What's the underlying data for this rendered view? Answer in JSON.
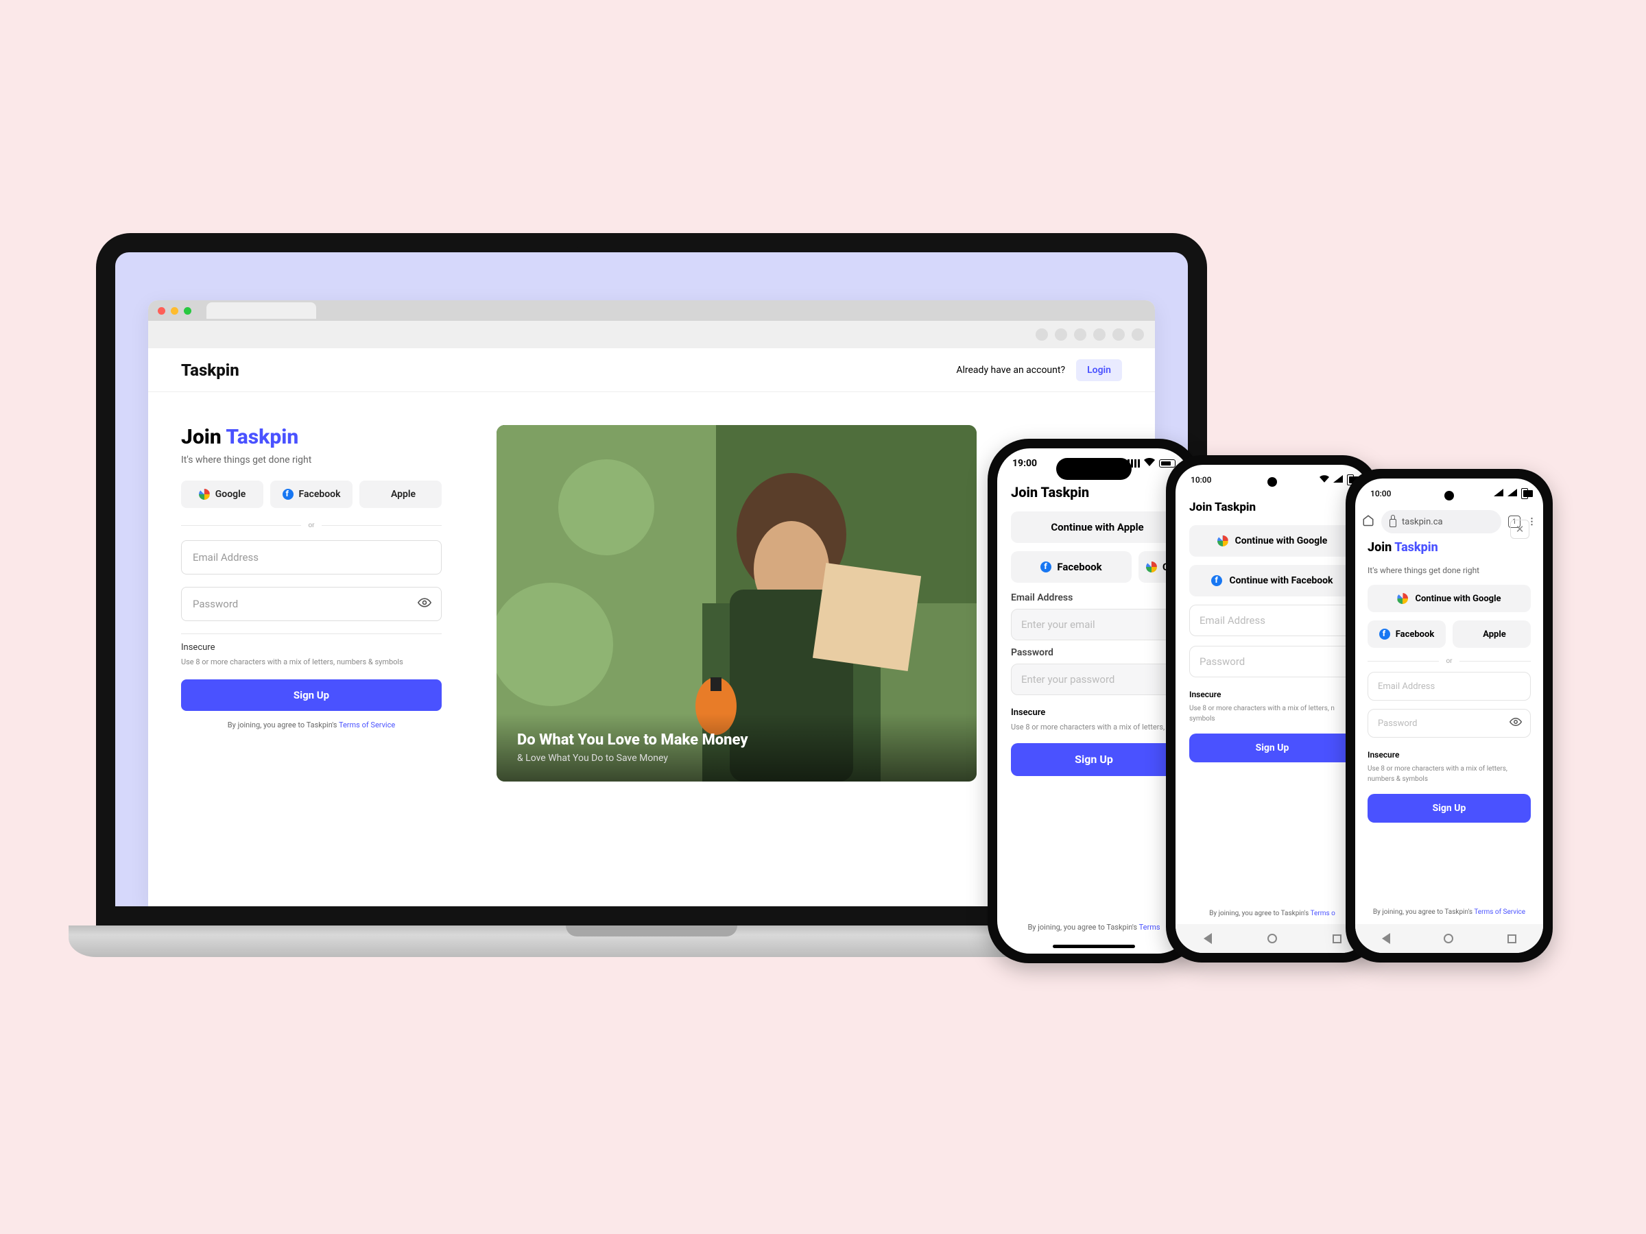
{
  "laptop": {
    "brand": "Taskpin",
    "header_prompt": "Already have an account?",
    "login": "Login",
    "join_prefix": "Join ",
    "join_brand": "Taskpin",
    "join_sub": "It's where things get done right",
    "sso": {
      "google": "Google",
      "facebook": "Facebook",
      "apple": "Apple"
    },
    "or": "or",
    "email_placeholder": "Email Address",
    "password_placeholder": "Password",
    "insecure": "Insecure",
    "hint": "Use 8 or more characters with a mix of letters, numbers & symbols",
    "signup": "Sign Up",
    "tos_prefix": "By joining, you agree to Taskpin's ",
    "tos_link": "Terms of Service",
    "hero_title": "Do What You Love to Make Money",
    "hero_sub": "& Love What You Do to Save Money"
  },
  "phone1": {
    "time": "19:00",
    "title": "Join Taskpin",
    "apple_btn": "Continue with Apple",
    "facebook": "Facebook",
    "google_short": "G",
    "email_label": "Email Address",
    "email_placeholder": "Enter your email",
    "password_label": "Password",
    "password_placeholder": "Enter your password",
    "insecure": "Insecure",
    "hint": "Use 8 or more characters with a mix of letters,",
    "signup": "Sign Up",
    "tos_prefix": "By joining, you agree to Taskpin's ",
    "tos_link": "Terms"
  },
  "phone2": {
    "time": "10:00",
    "title": "Join Taskpin",
    "google_btn": "Continue with Google",
    "facebook_btn": "Continue with Facebook",
    "email_placeholder": "Email Address",
    "password_placeholder": "Password",
    "insecure": "Insecure",
    "hint": "Use 8 or more characters with a mix of letters, n symbols",
    "signup": "Sign Up",
    "tos_prefix": "By joining, you agree to Taskpin's ",
    "tos_link": "Terms o"
  },
  "phone3": {
    "time": "10:00",
    "url": "taskpin.ca",
    "join_prefix": "Join ",
    "join_brand": "Taskpin",
    "join_sub": "It's where things get done right",
    "google_btn": "Continue with Google",
    "facebook": "Facebook",
    "apple": "Apple",
    "or": "or",
    "email_placeholder": "Email Address",
    "password_placeholder": "Password",
    "insecure": "Insecure",
    "hint": "Use 8 or more characters with a mix of letters, numbers & symbols",
    "signup": "Sign Up",
    "tos_prefix": "By joining, you agree to Taskpin's ",
    "tos_link": "Terms of Service"
  }
}
